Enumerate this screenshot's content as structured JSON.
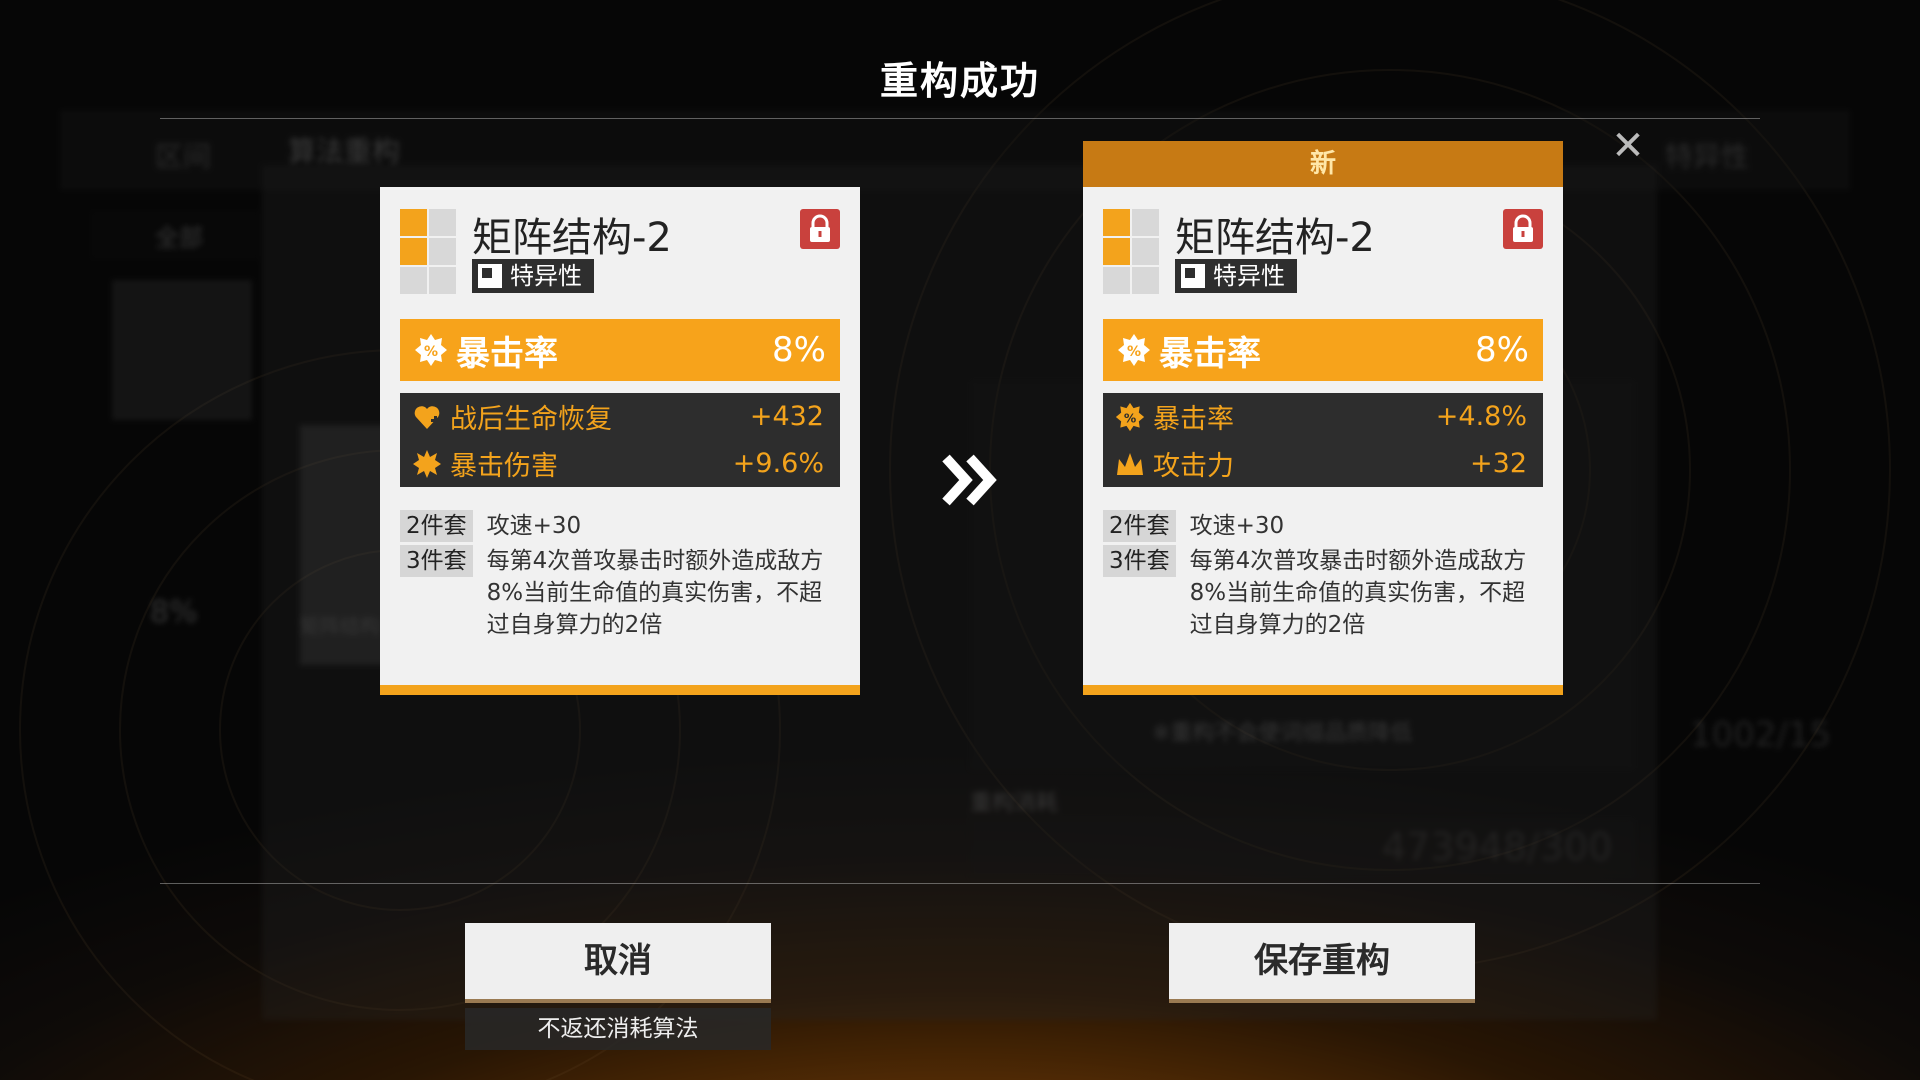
{
  "dialog": {
    "title": "重构成功",
    "close_glyph": "✕"
  },
  "background": {
    "tab_left": "区间",
    "tab_active": "算法重构",
    "tab_right": "特异性",
    "filter_all": "全部",
    "notice": "※重构不会使词缀品质降低",
    "cost_label": "重构消耗",
    "cost_value": "473948/300",
    "count_value": "1002/15",
    "item_caption": "矩阵结构",
    "item_stat": "8%"
  },
  "cards": {
    "old": {
      "name": "矩阵结构-2",
      "type": "特异性",
      "main_stat": {
        "name": "暴击率",
        "value": "8%",
        "icon": "crit-rate-icon"
      },
      "sub_stats": [
        {
          "name": "战后生命恢复",
          "value": "+432",
          "icon": "heart-heal-icon"
        },
        {
          "name": "暴击伤害",
          "value": "+9.6%",
          "icon": "crit-damage-icon"
        }
      ],
      "sets": [
        {
          "tag": "2件套",
          "text": "攻速+30"
        },
        {
          "tag": "3件套",
          "text": "每第4次普攻暴击时额外造成敌方8%当前生命值的真实伤害，不超过自身算力的2倍"
        }
      ]
    },
    "new": {
      "badge": "新",
      "name": "矩阵结构-2",
      "type": "特异性",
      "main_stat": {
        "name": "暴击率",
        "value": "8%",
        "icon": "crit-rate-icon"
      },
      "sub_stats": [
        {
          "name": "暴击率",
          "value": "+4.8%",
          "icon": "crit-rate-icon"
        },
        {
          "name": "攻击力",
          "value": "+32",
          "icon": "attack-crown-icon"
        }
      ],
      "sets": [
        {
          "tag": "2件套",
          "text": "攻速+30"
        },
        {
          "tag": "3件套",
          "text": "每第4次普攻暴击时额外造成敌方8%当前生命值的真实伤害，不超过自身算力的2倍"
        }
      ]
    }
  },
  "buttons": {
    "cancel": "取消",
    "cancel_note": "不返还消耗算法",
    "save": "保存重构"
  },
  "colors": {
    "accent": "#f7a31b",
    "lock": "#c9413d",
    "card_bg": "#f1f1f1",
    "substat_bg": "#2d2d2d"
  }
}
